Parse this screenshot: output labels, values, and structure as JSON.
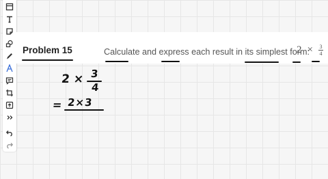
{
  "toolbar": {
    "tools": [
      "select-rect-icon",
      "text-icon",
      "sticky-note-icon",
      "shapes-icon",
      "pen-icon",
      "highlighter-icon",
      "comment-icon",
      "crop-icon",
      "insert-image-icon",
      "more-tools-icon",
      "undo-icon",
      "redo-icon"
    ]
  },
  "problem": {
    "title": "Problem 15",
    "question": "Calculate and express each result in its simplest form:",
    "expr_whole": "2",
    "expr_times": "×",
    "expr_num": "3",
    "expr_den": "4"
  },
  "handwriting": {
    "line1_left": "2 ×",
    "line1_num": "3",
    "line1_den": "4",
    "line2_eq": "=",
    "line2_num": "2×3"
  },
  "colors": {
    "accent": "#3b6fd8",
    "ink": "#111111",
    "grid": "#e6e6e6"
  }
}
